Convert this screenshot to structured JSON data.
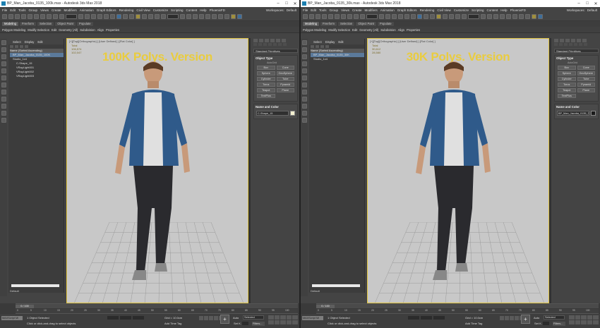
{
  "windows": [
    {
      "title": "BP_Man_Jacoba_0135_100k.max - Autodesk 3ds Max 2018",
      "menu": [
        "File",
        "Edit",
        "Tools",
        "Group",
        "Views",
        "Create",
        "Modifiers",
        "Animation",
        "Graph Editors",
        "Rendering",
        "Civil View",
        "Customize",
        "Scripting",
        "Content",
        "Help",
        "PhoenixFD"
      ],
      "workspace_label": "Workspaces:",
      "workspace_value": "Default",
      "ribbon_tabs": [
        "Modeling",
        "Freeform",
        "Selection",
        "Object Paint",
        "Populate"
      ],
      "subribbon": [
        "Polygon Modeling",
        "Modify Selection",
        "Edit",
        "Geometry (All)",
        "Subdivision",
        "Align",
        "Properties"
      ],
      "scene_tabs": [
        "Select",
        "Display",
        "Edit"
      ],
      "scene_tree": [
        "Name (Sorted Ascending)",
        "BP_Man_Jacoba_0135_100K",
        "Studio_1x4",
        "C-Shape_15",
        "VRayLight001",
        "VRayLight002",
        "VRayLight003"
      ],
      "scene_footer": "Default",
      "viewport_label": "[+][Top][Orthographic] ] [User Defined] ] [Flat Color] ]",
      "viewport_stats": [
        "Total",
        "106,574",
        "102,047"
      ],
      "overlay": "100K Polys. Version",
      "panel_dropdown": "Standard Primitives",
      "object_type_title": "Object Type",
      "autogrid": "AutoGrid",
      "object_buttons": [
        "Box",
        "Cone",
        "Sphere",
        "GeoSphere",
        "Cylinder",
        "Tube",
        "Torus",
        "Pyramid",
        "Teapot",
        "Plane",
        "TextPlus"
      ],
      "name_color_title": "Name and Color",
      "object_name": "C-Shape_15",
      "name_swatch": "#f2efcf",
      "frame": "0 / 100",
      "ruler": [
        "0",
        "5",
        "10",
        "15",
        "20",
        "25",
        "30",
        "35",
        "40",
        "45",
        "50",
        "55",
        "60",
        "65",
        "70",
        "75",
        "80",
        "85",
        "90",
        "95",
        "100"
      ],
      "maxscript": "MAXScript Mi",
      "status1": "1 Object Selected",
      "status2": "Click or click-and-drag to select objects",
      "grid": "Grid = 10.0cm",
      "add_tag": "Add Time Tag",
      "auto": "Auto",
      "selected": "Selected",
      "set_key": "Set K.",
      "filters": "Filters...",
      "frame_no": "0"
    },
    {
      "title": "BP_Man_Jacoba_0135_30k.max - Autodesk 3ds Max 2018",
      "menu": [
        "File",
        "Edit",
        "Tools",
        "Group",
        "Views",
        "Create",
        "Modifiers",
        "Animation",
        "Graph Editors",
        "Rendering",
        "Civil View",
        "Customize",
        "Scripting",
        "Content",
        "Help",
        "PhoenixFD"
      ],
      "workspace_label": "Workspaces:",
      "workspace_value": "Default",
      "ribbon_tabs": [
        "Modeling",
        "Freeform",
        "Selection",
        "Object Paint",
        "Populate"
      ],
      "subribbon": [
        "Polygon Modeling",
        "Modify Selection",
        "Edit",
        "Geometry (All)",
        "Subdivision",
        "Align",
        "Properties"
      ],
      "scene_tabs": [
        "Select",
        "Display",
        "Edit"
      ],
      "scene_tree": [
        "Name (Sorted Ascending)",
        "BP_Man_Jacoba_0135_30K",
        "Studio_1x4"
      ],
      "scene_footer": "Default",
      "viewport_label": "[+][Top][Orthographic] ] [User Defined] ] [Flat Color] ]",
      "viewport_stats": [
        "Total",
        "30,612",
        "28,580"
      ],
      "overlay": "30K Polys. Version",
      "panel_dropdown": "Standard Primitives",
      "object_type_title": "Object Type",
      "autogrid": "AutoGrid",
      "object_buttons": [
        "Box",
        "Cone",
        "Sphere",
        "GeoSphere",
        "Cylinder",
        "Tube",
        "Torus",
        "Pyramid",
        "Teapot",
        "Plane",
        "TextPlus"
      ],
      "name_color_title": "Name and Color",
      "object_name": "BP_Man_Jacoba_0135_30K",
      "name_swatch": "#1a1a1a",
      "frame": "0 / 100",
      "ruler": [
        "0",
        "5",
        "10",
        "15",
        "20",
        "25",
        "30",
        "35",
        "40",
        "45",
        "50",
        "55",
        "60",
        "65",
        "70",
        "75",
        "80",
        "85",
        "90",
        "95",
        "100"
      ],
      "maxscript": "MAXScript Mi",
      "status1": "1 Object Selected",
      "status2": "Click or click-and-drag to select objects",
      "grid": "Grid = 10.0cm",
      "add_tag": "Add Time Tag",
      "auto": "Auto",
      "selected": "Selected",
      "set_key": "Set K.",
      "filters": "Filters...",
      "frame_no": "0"
    }
  ],
  "colors": {
    "overlay_text": "#e9cc3f",
    "viewport_bg": "#c8c8c8",
    "active_border": "#e1c541",
    "ui_bg": "#444444"
  }
}
